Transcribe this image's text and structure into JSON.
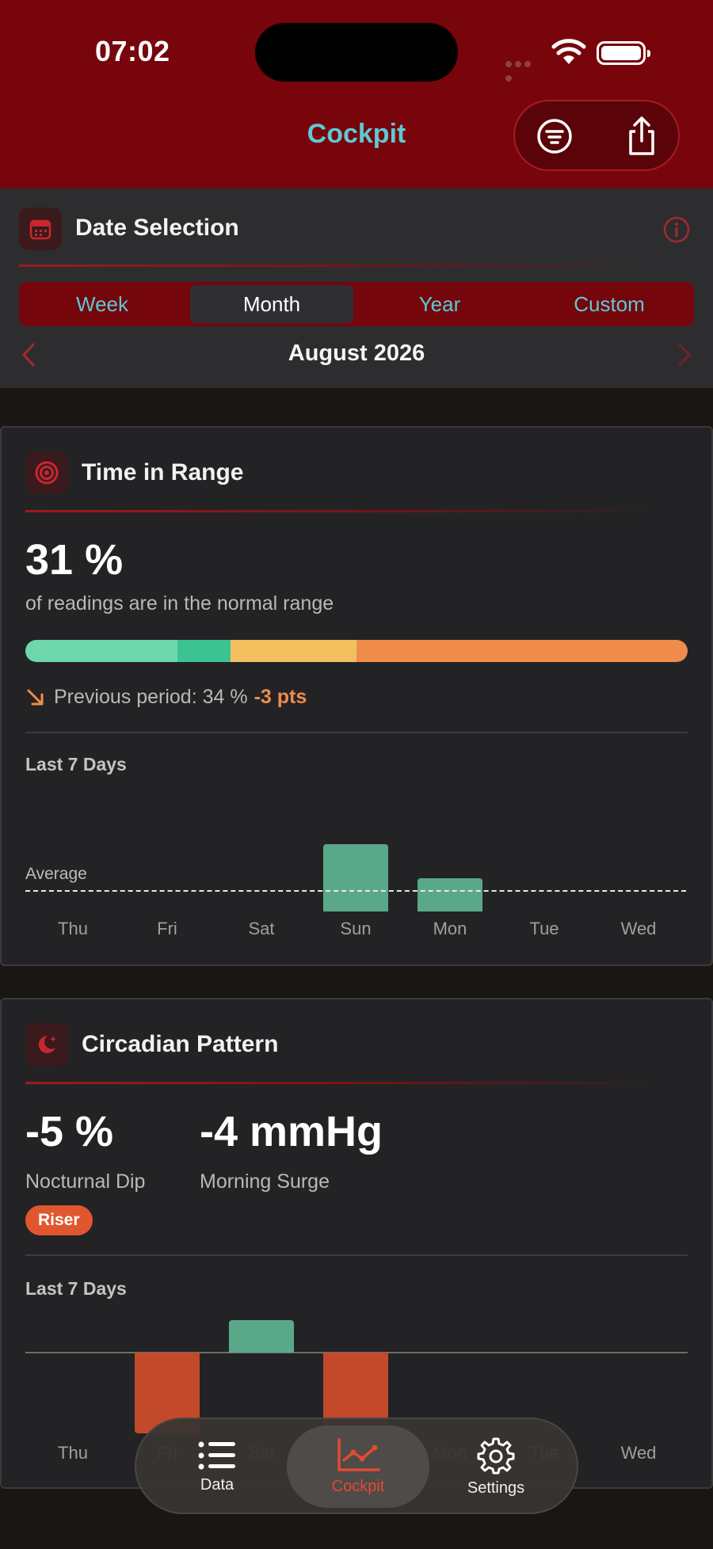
{
  "status": {
    "time": "07:02"
  },
  "nav": {
    "title": "Cockpit"
  },
  "date_selection": {
    "title": "Date Selection",
    "tabs": [
      "Week",
      "Month",
      "Year",
      "Custom"
    ],
    "selected_tab": "Month",
    "period": "August 2026"
  },
  "time_in_range": {
    "title": "Time in Range",
    "value": "31 %",
    "subtitle": "of readings are in the normal range",
    "previous_label": "Previous period: 34 %",
    "delta": "-3 pts",
    "distribution": [
      {
        "percent": 23,
        "color": "#6fd7ad"
      },
      {
        "percent": 8,
        "color": "#3cc394"
      },
      {
        "percent": 19,
        "color": "#f3c060"
      },
      {
        "percent": 50,
        "color": "#ef8c4b"
      }
    ],
    "chart_title": "Last 7 Days",
    "average_label": "Average"
  },
  "circadian": {
    "title": "Circadian Pattern",
    "dip_value": "-5 %",
    "dip_label": "Nocturnal Dip",
    "surge_value": "-4 mmHg",
    "surge_label": "Morning Surge",
    "badge": "Riser",
    "chart_title": "Last 7 Days"
  },
  "chart_data": [
    {
      "type": "bar",
      "title": "Last 7 Days",
      "categories": [
        "Thu",
        "Fri",
        "Sat",
        "Sun",
        "Mon",
        "Tue",
        "Wed"
      ],
      "values": [
        null,
        null,
        null,
        1.0,
        0.5,
        null,
        null
      ],
      "reference_line": "Average",
      "color": "#5aa88a"
    },
    {
      "type": "bar",
      "title": "Last 7 Days",
      "categories": [
        "Thu",
        "Fri",
        "Sat",
        "Sun",
        "Mon",
        "Tue",
        "Wed"
      ],
      "values": [
        null,
        -1.0,
        0.4,
        -1.0,
        null,
        null,
        null
      ],
      "positive_color": "#5aa88a",
      "negative_color": "#c2492a"
    }
  ],
  "tabbar": {
    "items": [
      {
        "label": "Data",
        "icon": "list-icon"
      },
      {
        "label": "Cockpit",
        "icon": "chart-icon"
      },
      {
        "label": "Settings",
        "icon": "gear-icon"
      }
    ],
    "active": "Cockpit"
  }
}
